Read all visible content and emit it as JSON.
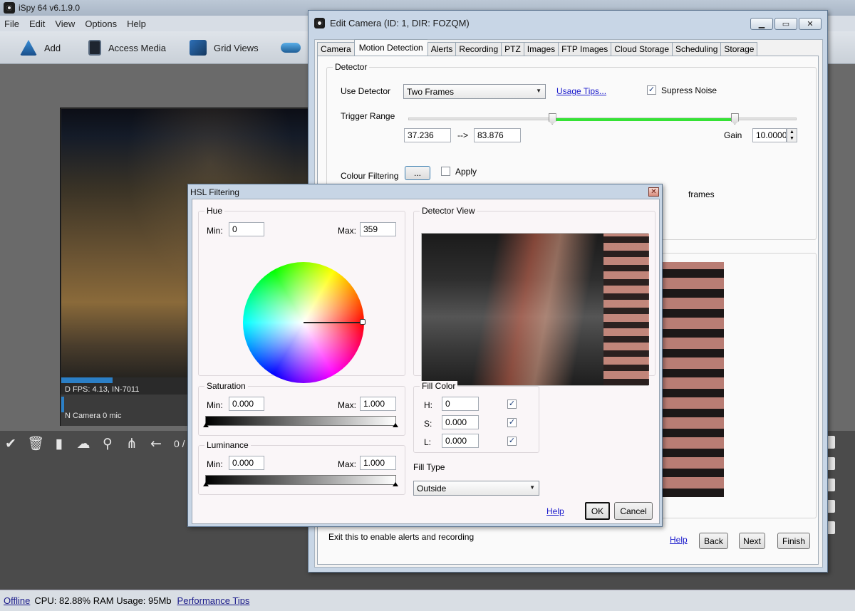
{
  "app": {
    "title": "iSpy 64 v6.1.9.0",
    "menu": [
      "File",
      "Edit",
      "View",
      "Options",
      "Help"
    ],
    "toolbar": [
      {
        "label": "Add",
        "icon": "add-camera-icon"
      },
      {
        "label": "Access Media",
        "icon": "access-media-icon"
      },
      {
        "label": "Grid Views",
        "icon": "grid-views-icon"
      },
      {
        "label": "",
        "icon": "cloud-icon"
      }
    ]
  },
  "camera_tile": {
    "info_line1": "D  FPS: 4.13, IN-7011",
    "info_line2": "N  Camera 0 mic",
    "count": "0 / 0",
    "tools": [
      "check-icon",
      "trash-icon",
      "book-icon",
      "cloud-upload-icon",
      "search-icon",
      "share-icon",
      "back-arrow-icon"
    ]
  },
  "status": {
    "offline": "Offline",
    "stats": "CPU: 82.88% RAM Usage: 95Mb",
    "perf_link": "Performance Tips"
  },
  "edit_camera": {
    "title": "Edit Camera (ID: 1, DIR: FOZQM)",
    "tabs": [
      "Camera",
      "Motion Detection",
      "Alerts",
      "Recording",
      "PTZ",
      "Images",
      "FTP Images",
      "Cloud Storage",
      "Scheduling",
      "Storage"
    ],
    "active_tab": "Motion Detection",
    "detector_group": "Detector",
    "use_detector_label": "Use Detector",
    "use_detector_value": "Two Frames",
    "usage_tips": "Usage Tips...",
    "supress_noise": "Supress Noise",
    "supress_noise_checked": true,
    "trigger_range_label": "Trigger Range",
    "trigger_min": "37.236",
    "arrow": "-->",
    "trigger_max": "83.876",
    "trigger_fraction": [
      0.37,
      0.84
    ],
    "gain_label": "Gain",
    "gain_value": "10.00000",
    "colour_filtering_label": "Colour Filtering",
    "colour_btn": "...",
    "apply_label": "Apply",
    "apply_checked": false,
    "frames_label": "frames",
    "footer_text": "Exit this to enable alerts and recording",
    "help": "Help",
    "back": "Back",
    "next": "Next",
    "finish": "Finish"
  },
  "hsl": {
    "title": "HSL Filtering",
    "hue": {
      "title": "Hue",
      "min_label": "Min:",
      "min": "0",
      "max_label": "Max:",
      "max": "359"
    },
    "saturation": {
      "title": "Saturation",
      "min_label": "Min:",
      "min": "0.000",
      "max_label": "Max:",
      "max": "1.000"
    },
    "luminance": {
      "title": "Luminance",
      "min_label": "Min:",
      "min": "0.000",
      "max_label": "Max:",
      "max": "1.000"
    },
    "detector_view_title": "Detector View",
    "fill_color": {
      "title": "Fill Color",
      "h_label": "H:",
      "h": "0",
      "s_label": "S:",
      "s": "0.000",
      "l_label": "L:",
      "l": "0.000",
      "h_checked": true,
      "s_checked": true,
      "l_checked": true
    },
    "fill_type_label": "Fill Type",
    "fill_type_value": "Outside",
    "help": "Help",
    "ok": "OK",
    "cancel": "Cancel"
  },
  "colors": {
    "accent": "#2b7fc6",
    "slider_green": "#35e235"
  }
}
